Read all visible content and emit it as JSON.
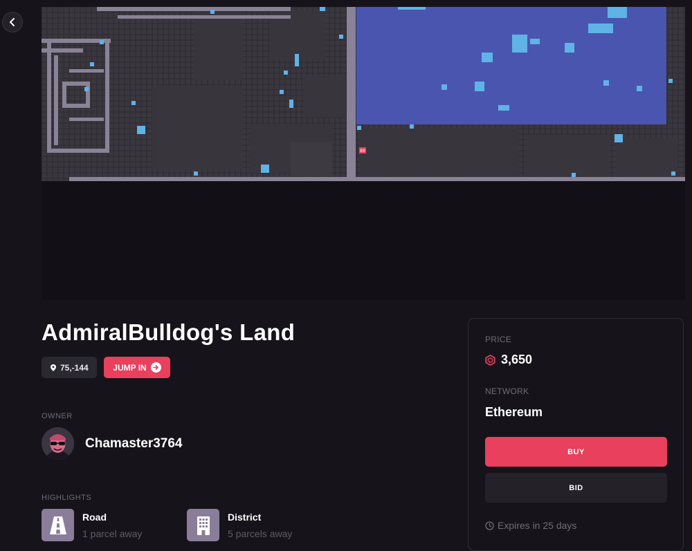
{
  "nav": {
    "back_icon": "chevron-left-icon"
  },
  "map": {
    "marker_label": "88",
    "colors": {
      "base": "#2c2a30",
      "block": "#38353d",
      "road": "#8a8296",
      "plaza": "#4a55b0",
      "highlight": "#5fb3e6",
      "marker": "#e8405d"
    }
  },
  "parcel": {
    "title": "AdmiralBulldog's Land",
    "coordinates": "75,-144",
    "coordinates_icon": "map-pin-icon",
    "jump_in_label": "JUMP IN",
    "jump_in_icon": "arrow-right-circle-icon"
  },
  "owner": {
    "section_label": "OWNER",
    "name": "Chamaster3764",
    "avatar": "avatar-with-sunglasses"
  },
  "highlights": {
    "section_label": "HIGHLIGHTS",
    "items": [
      {
        "icon": "road-icon",
        "title": "Road",
        "distance": "1 parcel away"
      },
      {
        "icon": "district-building-icon",
        "title": "District",
        "distance": "5 parcels away"
      }
    ]
  },
  "sale": {
    "price_label": "PRICE",
    "price_icon": "mana-hexagon-icon",
    "price": "3,650",
    "network_label": "NETWORK",
    "network": "Ethereum",
    "buy_label": "BUY",
    "bid_label": "BID",
    "expires_icon": "clock-icon",
    "expires": "Expires in 25 days"
  },
  "theme": {
    "background": "#16141a",
    "accent": "#e8405d",
    "muted_text": "#6f6c76"
  }
}
